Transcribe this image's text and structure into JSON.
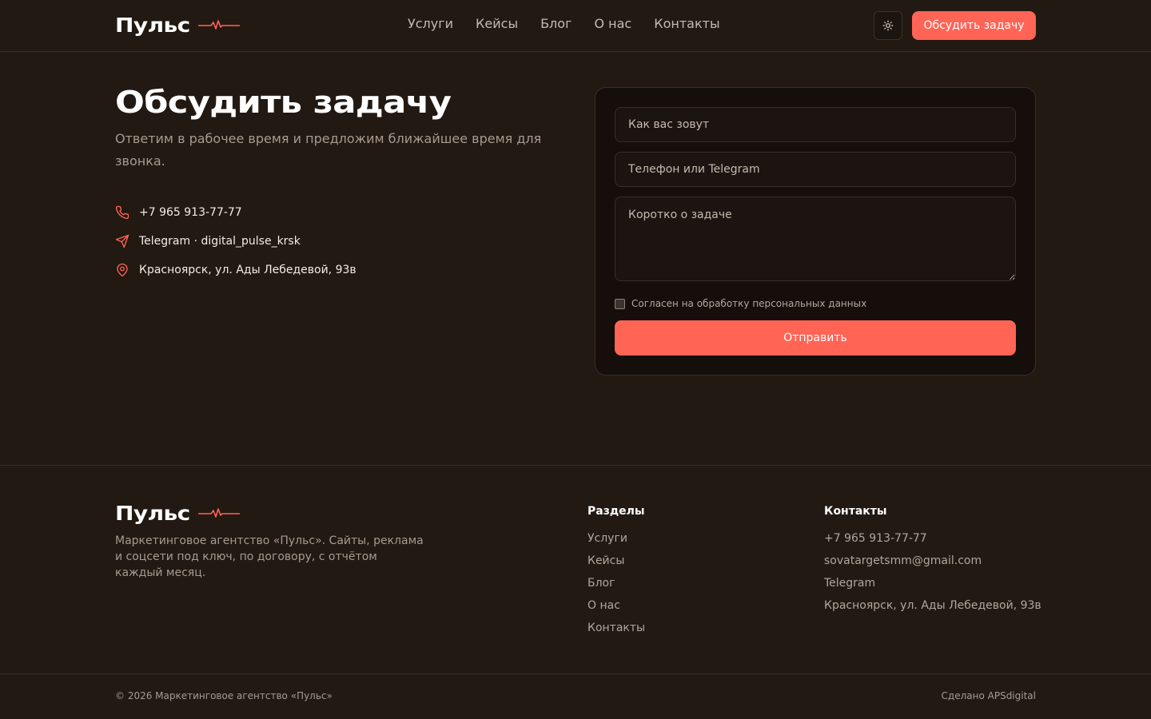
{
  "brand": {
    "name": "Пульс",
    "accent": "#ff6455"
  },
  "nav": {
    "items": [
      "Услуги",
      "Кейсы",
      "Блог",
      "О нас",
      "Контакты"
    ]
  },
  "header": {
    "theme_icon": "sun-icon",
    "cta_label": "Обсудить задачу"
  },
  "hero": {
    "title": "Обсудить задачу",
    "subtitle": "Ответим в рабочее время и предложим ближайшее время для звонка."
  },
  "contacts": [
    {
      "icon": "phone-icon",
      "text": "+7 965 913-77-77"
    },
    {
      "icon": "telegram-icon",
      "text": "Telegram · digital_pulse_krsk"
    },
    {
      "icon": "location-pin-icon",
      "text": "Красноярск, ул. Ады Лебедевой, 93в"
    }
  ],
  "form": {
    "name_placeholder": "Как вас зовут",
    "contact_placeholder": "Телефон или Telegram",
    "task_placeholder": "Коротко о задаче",
    "consent_label": "Согласен на обработку персональных данных",
    "submit_label": "Отправить"
  },
  "footer": {
    "description": "Маркетинговое агентство «Пульс». Сайты, реклама и соцсети под ключ, по договору, с отчётом каждый месяц.",
    "sections_title": "Разделы",
    "sections": [
      "Услуги",
      "Кейсы",
      "Блог",
      "О нас",
      "Контакты"
    ],
    "contacts_title": "Контакты",
    "contacts": [
      "+7 965 913-77-77",
      "sovatargetsmm@gmail.com",
      "Telegram",
      "Красноярск, ул. Ады Лебедевой, 93в"
    ],
    "copyright": "© 2026 Маркетинговое агентство «Пульс»",
    "made_by": "Сделано APSdigital"
  }
}
